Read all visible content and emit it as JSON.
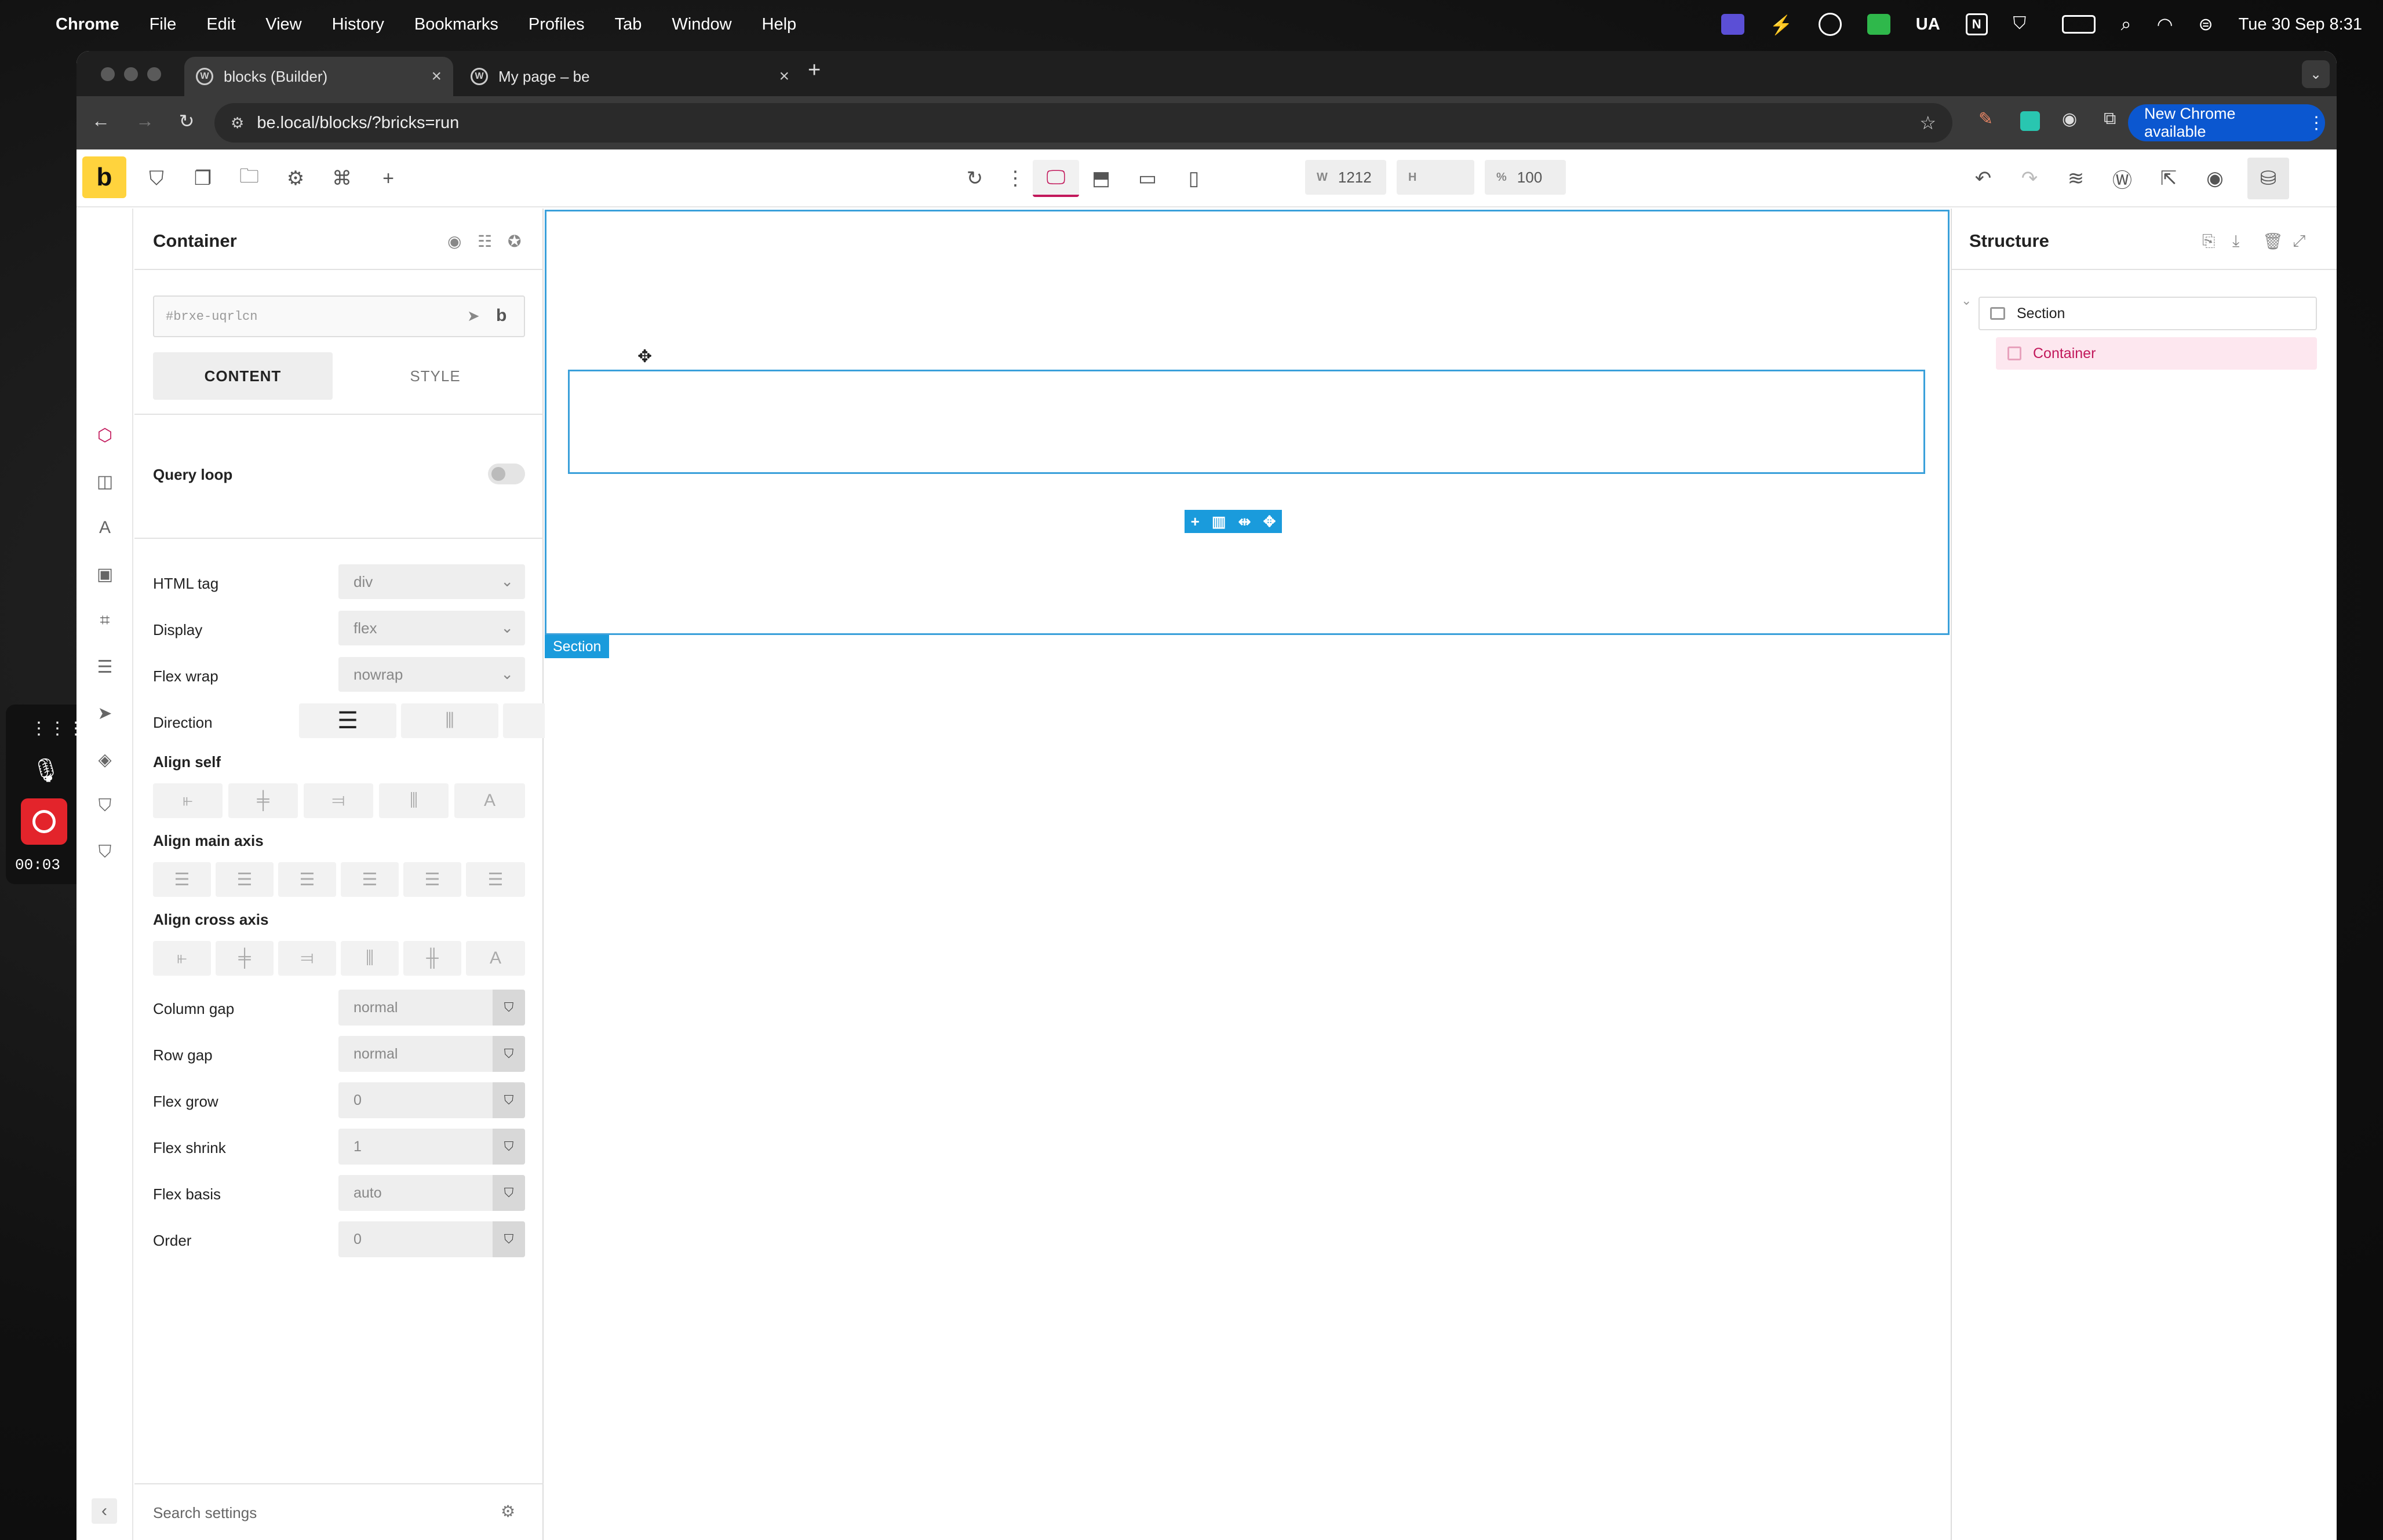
{
  "menubar": {
    "app": "Chrome",
    "items": [
      "File",
      "Edit",
      "View",
      "History",
      "Bookmarks",
      "Profiles",
      "Tab",
      "Window",
      "Help"
    ],
    "input_source": "UA",
    "datetime": "Tue 30 Sep  8:31"
  },
  "browser": {
    "tabs": [
      {
        "title": "blocks (Builder)",
        "active": true
      },
      {
        "title": "My page – be",
        "active": false
      }
    ],
    "url": "be.local/blocks/?bricks=run",
    "update_button": "New Chrome available"
  },
  "toolbar": {
    "logo": "b",
    "width_label": "W",
    "width_value": "1212",
    "height_label": "H",
    "height_value": "",
    "zoom_label": "%",
    "zoom_value": "100"
  },
  "left_panel": {
    "title": "Container",
    "id_placeholder": "#brxe-uqrlcn",
    "class_button": "b",
    "tabs": {
      "content": "CONTENT",
      "style": "STYLE"
    },
    "query_loop_label": "Query loop",
    "query_loop_on": false,
    "html_tag": {
      "label": "HTML tag",
      "value": "div"
    },
    "display": {
      "label": "Display",
      "value": "flex"
    },
    "flex_wrap": {
      "label": "Flex wrap",
      "value": "nowrap"
    },
    "direction_label": "Direction",
    "align_self_label": "Align self",
    "align_main_label": "Align main axis",
    "align_cross_label": "Align cross axis",
    "column_gap": {
      "label": "Column gap",
      "value": "normal"
    },
    "row_gap": {
      "label": "Row gap",
      "value": "normal"
    },
    "flex_grow": {
      "label": "Flex grow",
      "value": "0"
    },
    "flex_shrink": {
      "label": "Flex shrink",
      "value": "1"
    },
    "flex_basis": {
      "label": "Flex basis",
      "value": "auto"
    },
    "order": {
      "label": "Order",
      "value": "0"
    },
    "search_placeholder": "Search settings"
  },
  "canvas": {
    "section_label": "Section"
  },
  "structure": {
    "title": "Structure",
    "items": [
      {
        "label": "Section",
        "level": 0
      },
      {
        "label": "Container",
        "level": 1,
        "selected": true
      }
    ]
  },
  "recorder": {
    "time": "00:03"
  },
  "colors": {
    "bricks_yellow": "#ffd33d",
    "selection_blue": "#1a9bdc",
    "structure_selected": "#fde7ef",
    "structure_selected_text": "#c2185b",
    "chrome_update": "#0b57d0"
  }
}
